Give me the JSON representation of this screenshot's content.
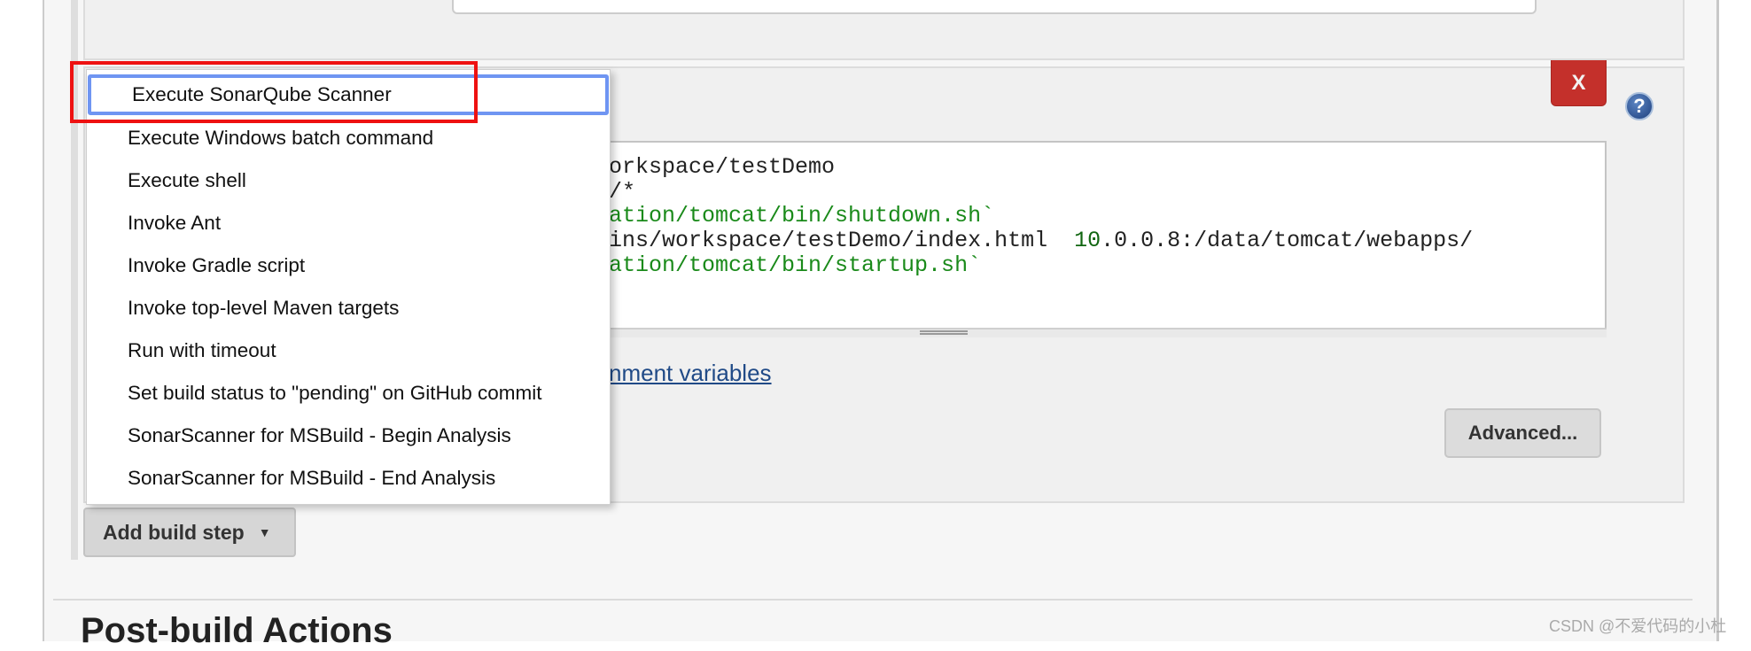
{
  "code_lines": [
    {
      "parts": [
        {
          "text": "orkspace/testDemo",
          "color": "default"
        }
      ]
    },
    {
      "parts": [
        {
          "text": "/*",
          "color": "default"
        }
      ]
    },
    {
      "parts": [
        {
          "text": "ation/tomcat/bin/shutdown.sh`",
          "color": "green"
        }
      ]
    },
    {
      "parts": [
        {
          "text": "ins/workspace/testDemo/index.html  ",
          "color": "default"
        },
        {
          "text": "10",
          "color": "dkgreen"
        },
        {
          "text": ".0.0.8:/data/tomcat/webapps/",
          "color": "default"
        }
      ]
    },
    {
      "parts": [
        {
          "text": "ation/tomcat/bin/startup.sh`",
          "color": "green"
        }
      ]
    }
  ],
  "env_link": "nment variables",
  "advanced_label": "Advanced...",
  "delete_label": "X",
  "help_label": "?",
  "add_build_step": {
    "label": "Add build step",
    "caret": "▼"
  },
  "menu": {
    "selected_index": 0,
    "items": [
      "Execute SonarQube Scanner",
      "Execute Windows batch command",
      "Execute shell",
      "Invoke Ant",
      "Invoke Gradle script",
      "Invoke top-level Maven targets",
      "Run with timeout",
      "Set build status to \"pending\" on GitHub commit",
      "SonarScanner for MSBuild - Begin Analysis",
      "SonarScanner for MSBuild - End Analysis"
    ]
  },
  "section_heading": "Post-build Actions",
  "watermark": "CSDN @不爱代码的小杜",
  "colors": {
    "delete_button": "#c4302b",
    "highlight_box": "#ee1111",
    "selection_border": "#6f95f2",
    "link": "#204a87",
    "code_green": "#1a8a1a"
  }
}
